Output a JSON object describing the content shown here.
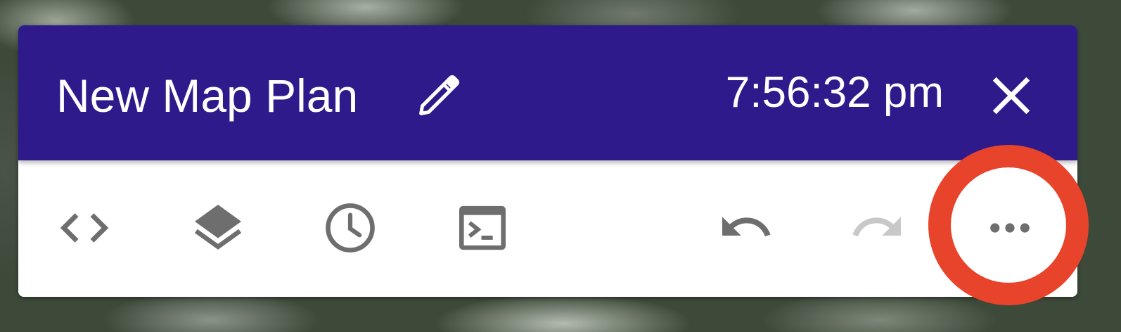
{
  "header": {
    "title": "New Map Plan",
    "time": "7:56:32 pm",
    "background_color": "#2e1a8a",
    "edit_icon": "pencil-icon",
    "close_icon": "close-icon"
  },
  "toolbar": {
    "left_tools": [
      {
        "id": "code",
        "icon": "code-brackets-icon"
      },
      {
        "id": "layers",
        "icon": "layers-icon"
      },
      {
        "id": "history",
        "icon": "clock-icon"
      },
      {
        "id": "console",
        "icon": "terminal-icon"
      }
    ],
    "right_tools": [
      {
        "id": "undo",
        "icon": "undo-icon",
        "enabled": true
      },
      {
        "id": "redo",
        "icon": "redo-icon",
        "enabled": false
      },
      {
        "id": "more",
        "icon": "more-horizontal-icon",
        "highlighted": true
      }
    ],
    "icon_color": "#6e6e6e",
    "disabled_icon_color": "#c8c8c8"
  },
  "annotation": {
    "highlight_color": "#e8432b",
    "target": "more"
  }
}
